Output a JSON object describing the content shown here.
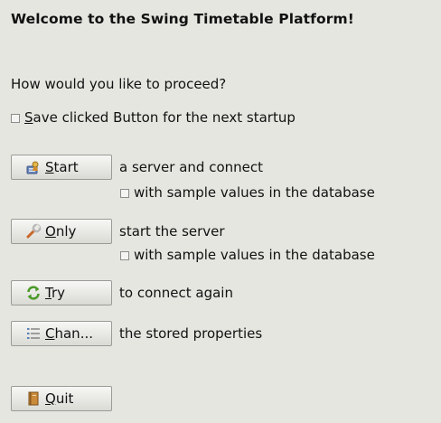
{
  "title": "Welcome to the Swing Timetable Platform!",
  "question": "How would you like to proceed?",
  "save_checkbox": {
    "mnemonic": "S",
    "rest": "ave clicked Button for the next startup",
    "checked": false
  },
  "actions": [
    {
      "icon": "server-start-icon",
      "mnemonic": "S",
      "rest": "tart",
      "description": "a server and connect",
      "sample_option": "with sample values in the database"
    },
    {
      "icon": "wrench-icon",
      "mnemonic": "O",
      "rest": "nly",
      "description": "start the server",
      "sample_option": "with sample values in the database"
    },
    {
      "icon": "refresh-icon",
      "mnemonic": "T",
      "rest": "ry",
      "description": "to connect again"
    },
    {
      "icon": "list-icon",
      "mnemonic": "C",
      "rest": "han...",
      "description": "the stored properties"
    },
    {
      "icon": "book-icon",
      "mnemonic": "Q",
      "rest": "uit"
    }
  ],
  "colors": {
    "background": "#e6e6e1",
    "button_border": "#9a9a96"
  }
}
